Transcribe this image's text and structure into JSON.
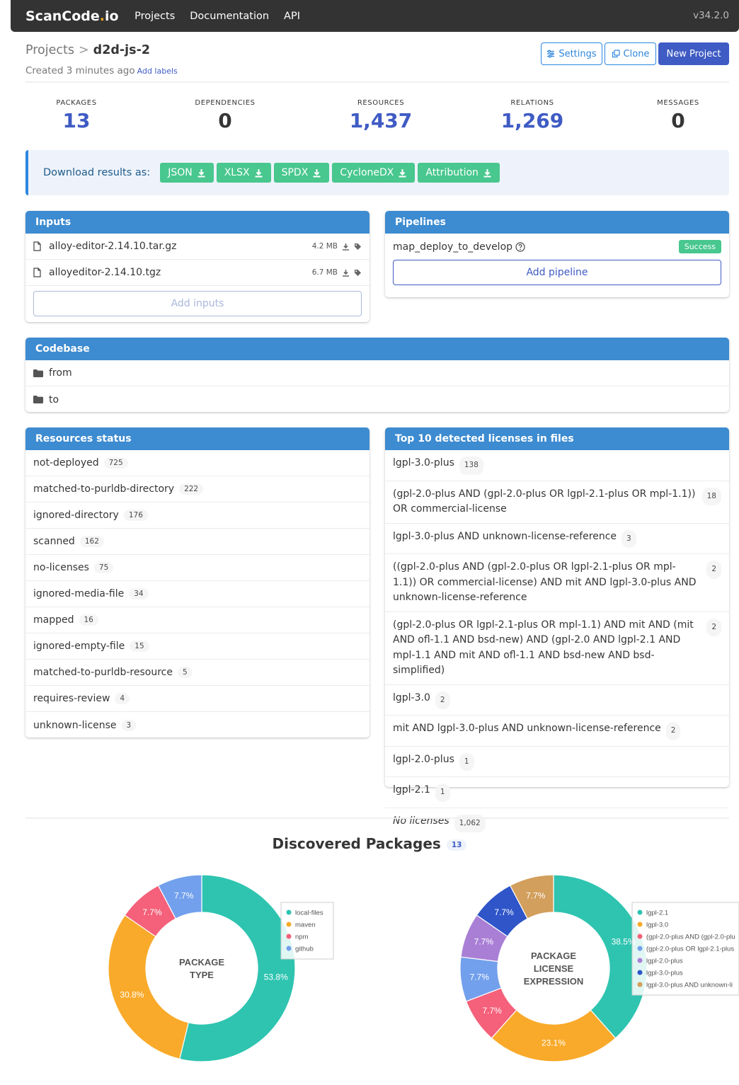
{
  "nav": {
    "brand_main": "ScanCode",
    "brand_dot": ".",
    "brand_end": "io",
    "links": [
      "Projects",
      "Documentation",
      "API"
    ],
    "version": "v34.2.0"
  },
  "header": {
    "breadcrumb_root": "Projects",
    "separator": ">",
    "project_name": "d2d-js-2",
    "created": "Created 3 minutes ago",
    "add_labels": "Add labels"
  },
  "actions": {
    "settings": "Settings",
    "clone": "Clone",
    "new_project": "New Project"
  },
  "stats": [
    {
      "label": "PACKAGES",
      "value": "13",
      "accent": true
    },
    {
      "label": "DEPENDENCIES",
      "value": "0",
      "accent": false
    },
    {
      "label": "RESOURCES",
      "value": "1,437",
      "accent": true
    },
    {
      "label": "RELATIONS",
      "value": "1,269",
      "accent": true
    },
    {
      "label": "MESSAGES",
      "value": "0",
      "accent": false
    }
  ],
  "download": {
    "label": "Download results as:",
    "formats": [
      "JSON",
      "XLSX",
      "SPDX",
      "CycloneDX",
      "Attribution"
    ]
  },
  "inputs": {
    "title": "Inputs",
    "files": [
      {
        "name": "alloy-editor-2.14.10.tar.gz",
        "size": "4.2 MB"
      },
      {
        "name": "alloyeditor-2.14.10.tgz",
        "size": "6.7 MB"
      }
    ],
    "add_label": "Add inputs"
  },
  "pipelines": {
    "title": "Pipelines",
    "items": [
      {
        "name": "map_deploy_to_develop",
        "status": "Success"
      }
    ],
    "add_label": "Add pipeline"
  },
  "codebase": {
    "title": "Codebase",
    "dirs": [
      "from",
      "to"
    ]
  },
  "resources_status": {
    "title": "Resources status",
    "items": [
      {
        "label": "not-deployed",
        "count": "725"
      },
      {
        "label": "matched-to-purldb-directory",
        "count": "222"
      },
      {
        "label": "ignored-directory",
        "count": "176"
      },
      {
        "label": "scanned",
        "count": "162"
      },
      {
        "label": "no-licenses",
        "count": "75"
      },
      {
        "label": "ignored-media-file",
        "count": "34"
      },
      {
        "label": "mapped",
        "count": "16"
      },
      {
        "label": "ignored-empty-file",
        "count": "15"
      },
      {
        "label": "matched-to-purldb-resource",
        "count": "5"
      },
      {
        "label": "requires-review",
        "count": "4"
      },
      {
        "label": "unknown-license",
        "count": "3"
      }
    ]
  },
  "licenses": {
    "title": "Top 10 detected licenses in files",
    "items": [
      {
        "label": "lgpl-3.0-plus",
        "count": "138"
      },
      {
        "label": "(gpl-2.0-plus AND (gpl-2.0-plus OR lgpl-2.1-plus OR mpl-1.1)) OR commercial-license",
        "count": "18"
      },
      {
        "label": "lgpl-3.0-plus AND unknown-license-reference",
        "count": "3"
      },
      {
        "label": "((gpl-2.0-plus AND (gpl-2.0-plus OR lgpl-2.1-plus OR mpl-1.1)) OR commercial-license) AND mit AND lgpl-3.0-plus AND unknown-license-reference",
        "count": "2"
      },
      {
        "label": "(gpl-2.0-plus OR lgpl-2.1-plus OR mpl-1.1) AND mit AND (mit AND ofl-1.1 AND bsd-new) AND (gpl-2.0 AND lgpl-2.1 AND mpl-1.1 AND mit AND ofl-1.1 AND bsd-new AND bsd-simplified)",
        "count": "2"
      },
      {
        "label": "lgpl-3.0",
        "count": "2"
      },
      {
        "label": "mit AND lgpl-3.0-plus AND unknown-license-reference",
        "count": "2"
      },
      {
        "label": "lgpl-2.0-plus",
        "count": "1"
      },
      {
        "label": "lgpl-2.1",
        "count": "1"
      },
      {
        "label": "No licenses",
        "count": "1,062",
        "italic": true
      }
    ]
  },
  "packages_section": {
    "title": "Discovered Packages",
    "count": "13"
  },
  "chart_data": [
    {
      "type": "pie",
      "center_label": [
        "PACKAGE",
        "TYPE"
      ],
      "slices": [
        {
          "label": "local-files",
          "value": 53.8,
          "display": "53.8%",
          "color": "#2ec4b0"
        },
        {
          "label": "maven",
          "value": 30.8,
          "display": "30.8%",
          "color": "#f9aa2a"
        },
        {
          "label": "npm",
          "value": 7.7,
          "display": "7.7%",
          "color": "#f5607a"
        },
        {
          "label": "github",
          "value": 7.7,
          "display": "7.7%",
          "color": "#72a0ec"
        }
      ]
    },
    {
      "type": "pie",
      "center_label": [
        "PACKAGE",
        "LICENSE",
        "EXPRESSION"
      ],
      "slices": [
        {
          "label": "lgpl-2.1",
          "value": 38.5,
          "display": "38.5%",
          "color": "#2ec4b0"
        },
        {
          "label": "lgpl-3.0",
          "value": 23.1,
          "display": "23.1%",
          "color": "#f9aa2a"
        },
        {
          "label": "(gpl-2.0-plus AND (gpl-2.0-plu",
          "value": 7.7,
          "display": "7.7%",
          "color": "#f5607a"
        },
        {
          "label": "(gpl-2.0-plus OR lgpl-2.1-plus",
          "value": 7.7,
          "display": "7.7%",
          "color": "#72a0ec"
        },
        {
          "label": "lgpl-2.0-plus",
          "value": 7.7,
          "display": "7.7%",
          "color": "#a97fd6"
        },
        {
          "label": "lgpl-3.0-plus",
          "value": 7.7,
          "display": "7.7%",
          "color": "#2f55c8"
        },
        {
          "label": "lgpl-3.0-plus AND unknown-li",
          "value": 7.7,
          "display": "7.7%",
          "color": "#d29f5c"
        }
      ]
    }
  ]
}
